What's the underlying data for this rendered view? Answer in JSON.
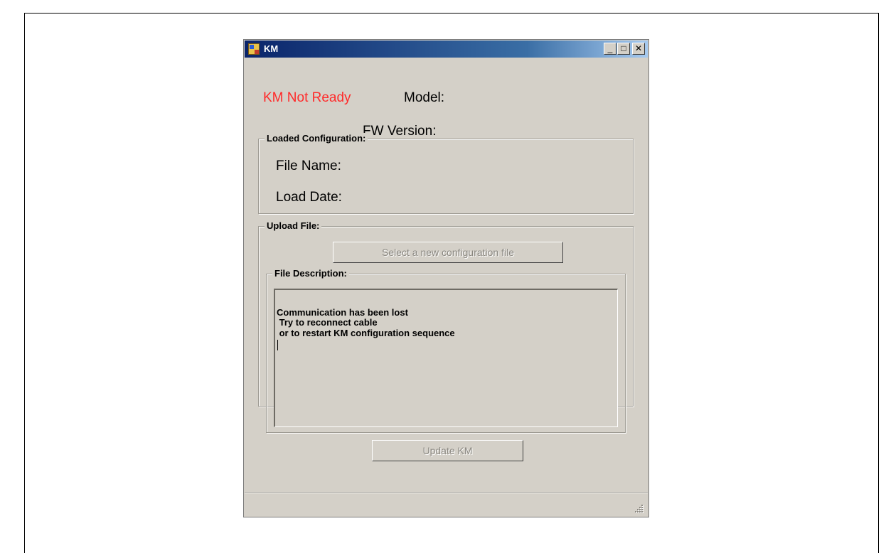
{
  "window": {
    "title": "KM",
    "minimize_glyph": "_",
    "maximize_glyph": "□",
    "close_glyph": "✕"
  },
  "status": {
    "text": "KM Not Ready",
    "color": "#ff2a2a"
  },
  "device": {
    "model_label": "Model:",
    "fw_label": "FW Version:"
  },
  "loaded_config": {
    "legend": "Loaded Configuration:",
    "file_name_label": "File Name:",
    "load_date_label": "Load Date:"
  },
  "upload": {
    "legend": "Upload File:",
    "select_button": "Select a new configuration file",
    "description_legend": "File Description:",
    "description_lines": [
      "Communication has been lost",
      " Try to reconnect cable",
      " or to restart KM configuration sequence"
    ],
    "update_button": "Update KM"
  },
  "icons": {
    "app": "app-window-icon",
    "grip": "resize-grip-icon"
  }
}
